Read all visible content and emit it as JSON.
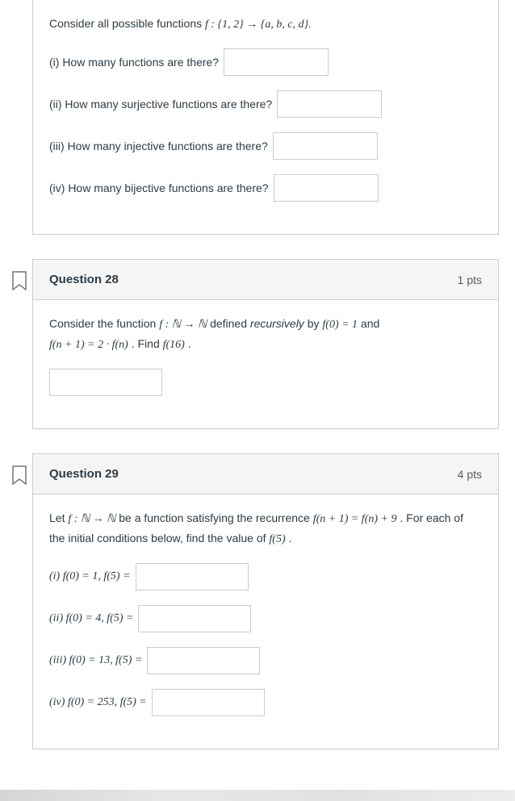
{
  "q27": {
    "intro_pre": "Consider all possible functions ",
    "intro_math": "f : {1, 2} → {a, b, c, d}.",
    "p1": "(i) How many functions are there?",
    "p2": "(ii) How many surjective functions are there?",
    "p3": "(iii) How many injective functions are there?",
    "p4": "(iv) How many bijective functions are there?"
  },
  "q28": {
    "title": "Question 28",
    "pts": "1 pts",
    "line1_a": "Consider the function ",
    "line1_b": "f : ℕ → ℕ",
    "line1_c": " defined ",
    "line1_d": "recursively",
    "line1_e": " by ",
    "line1_f": "f(0) = 1",
    "line1_g": " and ",
    "line2_a": "f(n + 1) = 2 · f(n)",
    "line2_b": ". Find ",
    "line2_c": "f(16)",
    "line2_d": "."
  },
  "q29": {
    "title": "Question 29",
    "pts": "4 pts",
    "intro_a": "Let ",
    "intro_b": "f : ℕ → ℕ",
    "intro_c": " be a function satisfying the recurrence ",
    "intro_d": "f(n + 1) = f(n) + 9",
    "intro_e": ". For each of the initial conditions below, find the value of ",
    "intro_f": "f(5)",
    "intro_g": ".",
    "i": "(i) f(0) = 1, f(5) =",
    "ii": "(ii) f(0) = 4, f(5) =",
    "iii": "(iii) f(0) = 13, f(5) =",
    "iv": "(iv) f(0) = 253, f(5) ="
  }
}
